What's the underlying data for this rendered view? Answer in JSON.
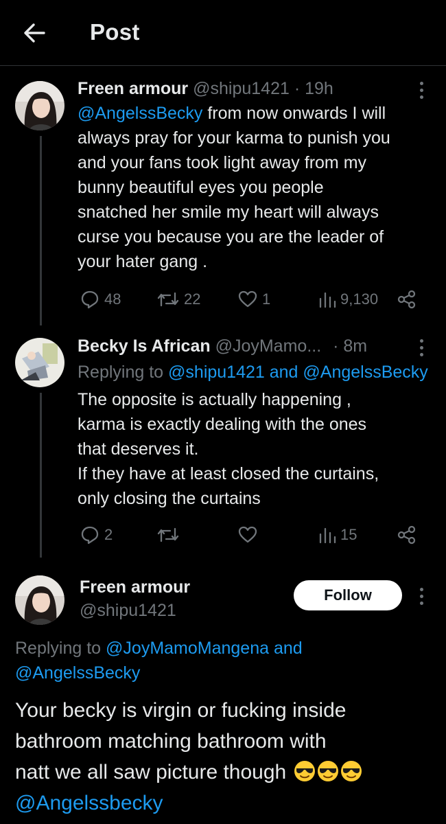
{
  "header": {
    "title": "Post"
  },
  "tweet1": {
    "name": "Freen armour",
    "handle": "@shipu1421",
    "time": "· 19h",
    "mention": "@AngelssBecky",
    "lines": [
      " from now onwards I will",
      "always pray for your karma to punish you",
      "and your fans took light away from my",
      "bunny beautiful eyes you people",
      "snatched her smile my heart will always",
      "curse you because you are the leader of",
      "your hater gang ."
    ],
    "replies": "48",
    "reposts": "22",
    "likes": "1",
    "views": "9,130"
  },
  "tweet2": {
    "name": "Becky Is African",
    "handle": "@JoyMamo...",
    "time": "· 8m",
    "replying_prefix": "Replying to ",
    "replying_to": "@shipu1421 and @AngelssBecky",
    "lines": [
      "The opposite is actually happening ,",
      "karma is exactly dealing with the ones",
      "that deserves it.",
      "If they have at least closed the curtains,",
      "only closing the curtains"
    ],
    "replies": "2",
    "views": "15"
  },
  "main_post": {
    "name": "Freen armour",
    "handle": "@shipu1421",
    "follow_label": "Follow",
    "replying_prefix": "Replying to ",
    "replying_to_line1": "@JoyMamoMangena and",
    "replying_to_line2": "@AngelssBecky",
    "lines": [
      "Your becky is virgin or fucking inside",
      "bathroom matching bathroom with",
      "natt we all saw picture though"
    ],
    "emojis": [
      "smiling-face-with-sunglasses",
      "smiling-face-with-sunglasses",
      "smiling-face-with-sunglasses"
    ],
    "final_mention": "@Angelssbecky"
  },
  "colors": {
    "background": "#000000",
    "text": "#e7e9ea",
    "muted": "#71767b",
    "link": "#1d9bf0",
    "divider": "#2f3336"
  }
}
